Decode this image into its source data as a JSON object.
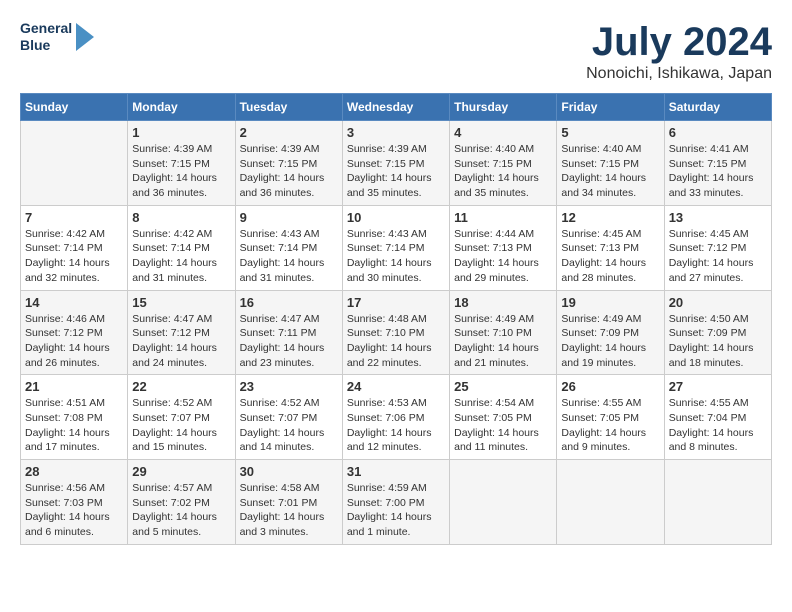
{
  "logo": {
    "line1": "General",
    "line2": "Blue"
  },
  "title": "July 2024",
  "subtitle": "Nonoichi, Ishikawa, Japan",
  "weekdays": [
    "Sunday",
    "Monday",
    "Tuesday",
    "Wednesday",
    "Thursday",
    "Friday",
    "Saturday"
  ],
  "weeks": [
    [
      {
        "day": "",
        "info": ""
      },
      {
        "day": "1",
        "info": "Sunrise: 4:39 AM\nSunset: 7:15 PM\nDaylight: 14 hours\nand 36 minutes."
      },
      {
        "day": "2",
        "info": "Sunrise: 4:39 AM\nSunset: 7:15 PM\nDaylight: 14 hours\nand 36 minutes."
      },
      {
        "day": "3",
        "info": "Sunrise: 4:39 AM\nSunset: 7:15 PM\nDaylight: 14 hours\nand 35 minutes."
      },
      {
        "day": "4",
        "info": "Sunrise: 4:40 AM\nSunset: 7:15 PM\nDaylight: 14 hours\nand 35 minutes."
      },
      {
        "day": "5",
        "info": "Sunrise: 4:40 AM\nSunset: 7:15 PM\nDaylight: 14 hours\nand 34 minutes."
      },
      {
        "day": "6",
        "info": "Sunrise: 4:41 AM\nSunset: 7:15 PM\nDaylight: 14 hours\nand 33 minutes."
      }
    ],
    [
      {
        "day": "7",
        "info": "Sunrise: 4:42 AM\nSunset: 7:14 PM\nDaylight: 14 hours\nand 32 minutes."
      },
      {
        "day": "8",
        "info": "Sunrise: 4:42 AM\nSunset: 7:14 PM\nDaylight: 14 hours\nand 31 minutes."
      },
      {
        "day": "9",
        "info": "Sunrise: 4:43 AM\nSunset: 7:14 PM\nDaylight: 14 hours\nand 31 minutes."
      },
      {
        "day": "10",
        "info": "Sunrise: 4:43 AM\nSunset: 7:14 PM\nDaylight: 14 hours\nand 30 minutes."
      },
      {
        "day": "11",
        "info": "Sunrise: 4:44 AM\nSunset: 7:13 PM\nDaylight: 14 hours\nand 29 minutes."
      },
      {
        "day": "12",
        "info": "Sunrise: 4:45 AM\nSunset: 7:13 PM\nDaylight: 14 hours\nand 28 minutes."
      },
      {
        "day": "13",
        "info": "Sunrise: 4:45 AM\nSunset: 7:12 PM\nDaylight: 14 hours\nand 27 minutes."
      }
    ],
    [
      {
        "day": "14",
        "info": "Sunrise: 4:46 AM\nSunset: 7:12 PM\nDaylight: 14 hours\nand 26 minutes."
      },
      {
        "day": "15",
        "info": "Sunrise: 4:47 AM\nSunset: 7:12 PM\nDaylight: 14 hours\nand 24 minutes."
      },
      {
        "day": "16",
        "info": "Sunrise: 4:47 AM\nSunset: 7:11 PM\nDaylight: 14 hours\nand 23 minutes."
      },
      {
        "day": "17",
        "info": "Sunrise: 4:48 AM\nSunset: 7:10 PM\nDaylight: 14 hours\nand 22 minutes."
      },
      {
        "day": "18",
        "info": "Sunrise: 4:49 AM\nSunset: 7:10 PM\nDaylight: 14 hours\nand 21 minutes."
      },
      {
        "day": "19",
        "info": "Sunrise: 4:49 AM\nSunset: 7:09 PM\nDaylight: 14 hours\nand 19 minutes."
      },
      {
        "day": "20",
        "info": "Sunrise: 4:50 AM\nSunset: 7:09 PM\nDaylight: 14 hours\nand 18 minutes."
      }
    ],
    [
      {
        "day": "21",
        "info": "Sunrise: 4:51 AM\nSunset: 7:08 PM\nDaylight: 14 hours\nand 17 minutes."
      },
      {
        "day": "22",
        "info": "Sunrise: 4:52 AM\nSunset: 7:07 PM\nDaylight: 14 hours\nand 15 minutes."
      },
      {
        "day": "23",
        "info": "Sunrise: 4:52 AM\nSunset: 7:07 PM\nDaylight: 14 hours\nand 14 minutes."
      },
      {
        "day": "24",
        "info": "Sunrise: 4:53 AM\nSunset: 7:06 PM\nDaylight: 14 hours\nand 12 minutes."
      },
      {
        "day": "25",
        "info": "Sunrise: 4:54 AM\nSunset: 7:05 PM\nDaylight: 14 hours\nand 11 minutes."
      },
      {
        "day": "26",
        "info": "Sunrise: 4:55 AM\nSunset: 7:05 PM\nDaylight: 14 hours\nand 9 minutes."
      },
      {
        "day": "27",
        "info": "Sunrise: 4:55 AM\nSunset: 7:04 PM\nDaylight: 14 hours\nand 8 minutes."
      }
    ],
    [
      {
        "day": "28",
        "info": "Sunrise: 4:56 AM\nSunset: 7:03 PM\nDaylight: 14 hours\nand 6 minutes."
      },
      {
        "day": "29",
        "info": "Sunrise: 4:57 AM\nSunset: 7:02 PM\nDaylight: 14 hours\nand 5 minutes."
      },
      {
        "day": "30",
        "info": "Sunrise: 4:58 AM\nSunset: 7:01 PM\nDaylight: 14 hours\nand 3 minutes."
      },
      {
        "day": "31",
        "info": "Sunrise: 4:59 AM\nSunset: 7:00 PM\nDaylight: 14 hours\nand 1 minute."
      },
      {
        "day": "",
        "info": ""
      },
      {
        "day": "",
        "info": ""
      },
      {
        "day": "",
        "info": ""
      }
    ]
  ]
}
